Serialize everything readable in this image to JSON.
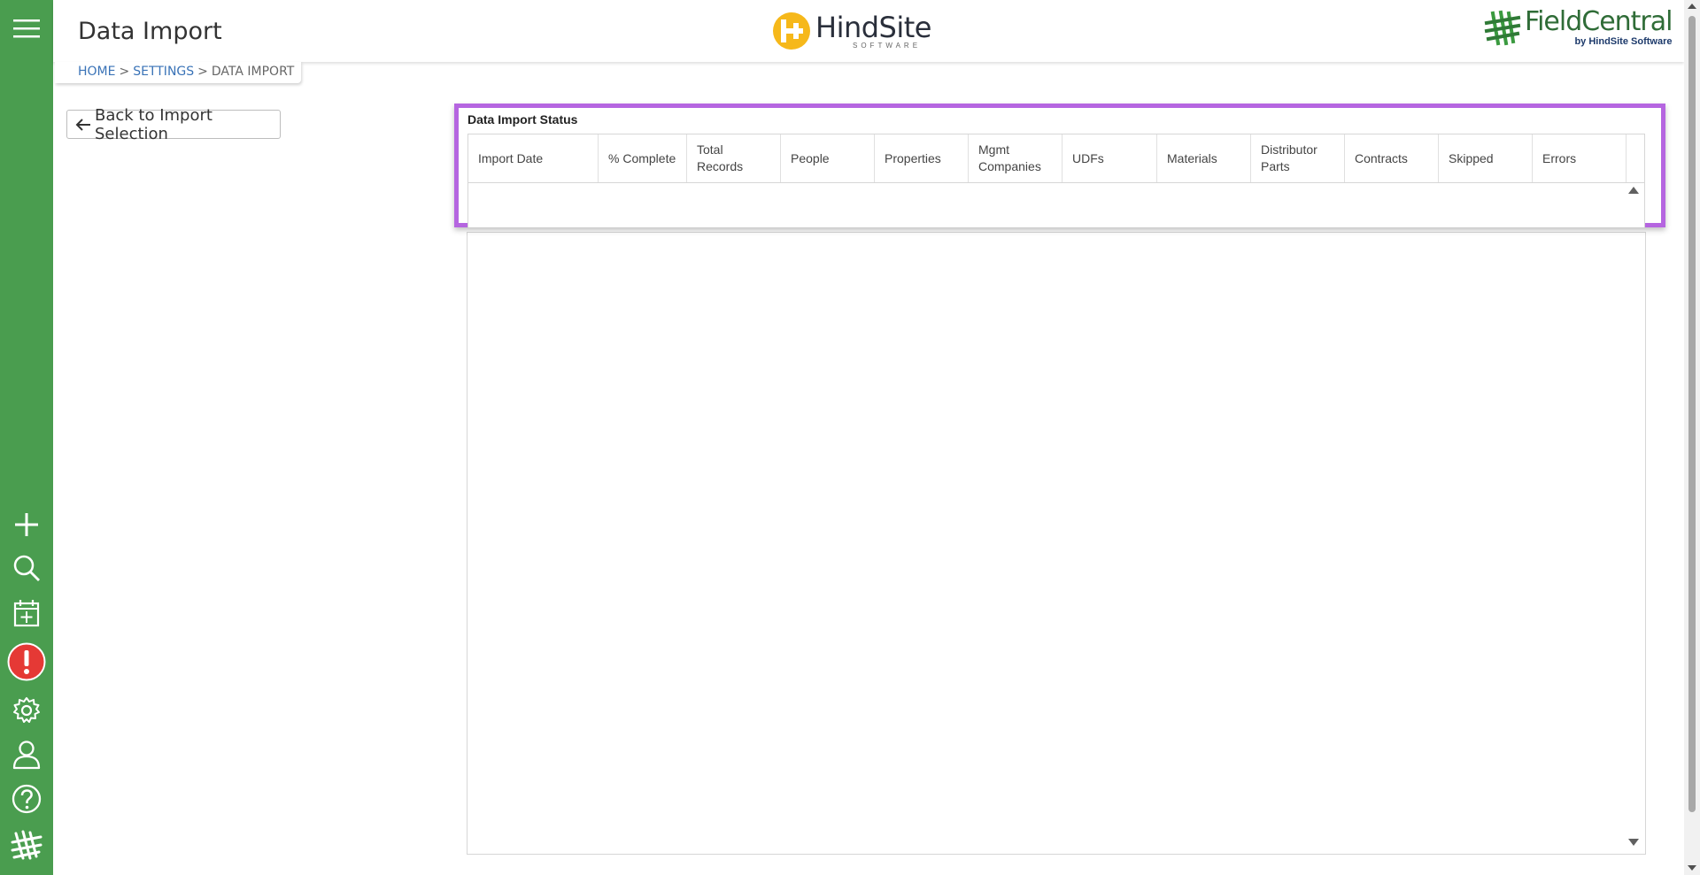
{
  "header": {
    "page_title": "Data Import",
    "hindsite_logo": {
      "name": "HindSite",
      "sub": "SOFTWARE"
    },
    "fieldcentral_logo": {
      "name": "FieldCentral",
      "by": "by HindSite Software"
    }
  },
  "breadcrumb": {
    "home": "HOME",
    "sep1": ">",
    "settings": "SETTINGS",
    "sep2": ">",
    "current": "DATA IMPORT"
  },
  "back_button": {
    "label": "Back to Import Selection",
    "icon": "arrow-left-icon"
  },
  "status_panel": {
    "title": "Data Import Status",
    "columns": [
      "Import Date",
      "% Complete",
      "Total Records",
      "People",
      "Properties",
      "Mgmt Companies",
      "UDFs",
      "Materials",
      "Distributor Parts",
      "Contracts",
      "Skipped",
      "Errors"
    ],
    "rows": []
  },
  "sidebar": {
    "icons": [
      "menu-icon",
      "add-icon",
      "search-icon",
      "calendar-add-icon",
      "alert-icon",
      "gear-icon",
      "user-icon",
      "help-icon",
      "fieldcentral-mark-icon"
    ]
  },
  "colors": {
    "sidebar": "#4a9d4f",
    "highlight": "#b565e0",
    "link": "#3a73b7",
    "alert": "#e53935",
    "hindsite_yellow": "#f6b81a",
    "fieldcentral_green": "#2f6c37"
  }
}
